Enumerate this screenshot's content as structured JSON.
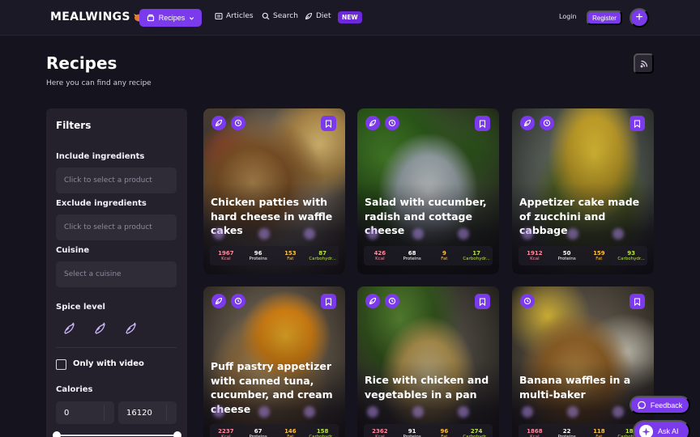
{
  "nav": {
    "logo": "MEALWINGS",
    "recipes_label": "Recipes",
    "articles_label": "Articles",
    "search_label": "Search",
    "diet_label": "Diet",
    "new_badge": "NEW",
    "login_label": "Login",
    "register_label": "Register",
    "plus_label": "+"
  },
  "header": {
    "title": "Recipes",
    "subtitle": "Here you can find any recipe"
  },
  "filters": {
    "title": "Filters",
    "include_label": "Include ingredients",
    "include_placeholder": "Click to select a product",
    "exclude_label": "Exclude ingredients",
    "exclude_placeholder": "Click to select a product",
    "cuisine_label": "Cuisine",
    "cuisine_placeholder": "Select a cuisine",
    "spice_label": "Spice level",
    "video_label": "Only with video",
    "calories_label": "Calories",
    "calories_min": "0",
    "calories_max": "16120"
  },
  "nutrition_labels": {
    "kcal": "Kcal",
    "proteins": "Proteins",
    "fat": "Fat",
    "carbs": "Carbohydr..."
  },
  "cards": [
    {
      "title": "Chicken patties with hard cheese in waffle cakes",
      "kcal": "1967",
      "proteins": "96",
      "fat": "153",
      "carbs": "87"
    },
    {
      "title": "Salad with cucumber, radish and cottage cheese",
      "kcal": "426",
      "proteins": "68",
      "fat": "9",
      "carbs": "17"
    },
    {
      "title": "Appetizer cake made of zucchini and cabbage",
      "kcal": "1912",
      "proteins": "50",
      "fat": "159",
      "carbs": "93"
    },
    {
      "title": "Puff pastry appetizer with canned tuna, cucumber, and cream cheese",
      "kcal": "2237",
      "proteins": "67",
      "fat": "146",
      "carbs": "158"
    },
    {
      "title": "Rice with chicken and vegetables in a pan",
      "kcal": "2362",
      "proteins": "91",
      "fat": "96",
      "carbs": "274"
    },
    {
      "title": "Banana waffles in a multi-baker",
      "kcal": "1868",
      "proteins": "22",
      "fat": "118",
      "carbs": "181"
    }
  ],
  "floating": {
    "feedback_label": "Feedback",
    "ask_ai_label": "Ask AI"
  },
  "colors": {
    "accent": "#7c3aed",
    "background": "#15131d",
    "panel": "#24212d",
    "kcal": "#ff8b9e",
    "fat": "#ffc23d",
    "carbs": "#b7e34a"
  }
}
